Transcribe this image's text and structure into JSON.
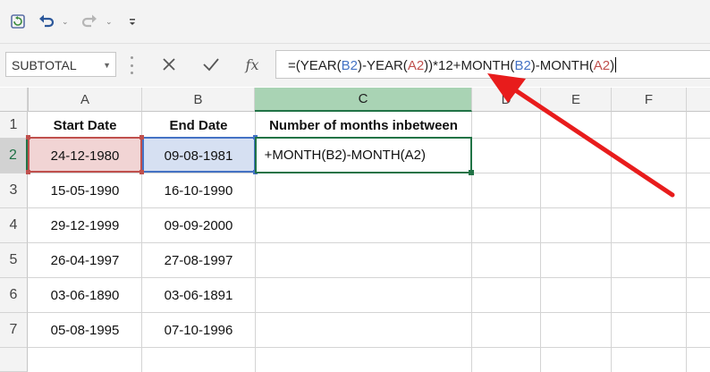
{
  "quick_access": {
    "icons": [
      "save-icon",
      "undo-icon",
      "redo-icon",
      "customize-icon"
    ]
  },
  "formula_bar": {
    "name_box": "SUBTOTAL",
    "fx_label": "fx",
    "formula_parts": [
      {
        "t": "=(YEAR(",
        "c": "n"
      },
      {
        "t": "B2",
        "c": "b"
      },
      {
        "t": ")-YEAR(",
        "c": "n"
      },
      {
        "t": "A2",
        "c": "a"
      },
      {
        "t": "))*12+MONTH(",
        "c": "n"
      },
      {
        "t": "B2",
        "c": "b"
      },
      {
        "t": ")-MONTH(",
        "c": "n"
      },
      {
        "t": "A2",
        "c": "a"
      },
      {
        "t": ")",
        "c": "n"
      }
    ]
  },
  "columns": [
    "A",
    "B",
    "C",
    "D",
    "E",
    "F"
  ],
  "rows": [
    "1",
    "2",
    "3",
    "4",
    "5",
    "6",
    "7"
  ],
  "headers": {
    "start_date": "Start Date",
    "end_date": "End Date",
    "months": "Number of months inbetween"
  },
  "data": [
    {
      "start": "24-12-1980",
      "end": "09-08-1981"
    },
    {
      "start": "15-05-1990",
      "end": "16-10-1990"
    },
    {
      "start": "29-12-1999",
      "end": "09-09-2000"
    },
    {
      "start": "26-04-1997",
      "end": "27-08-1997"
    },
    {
      "start": "03-06-1890",
      "end": "03-06-1891"
    },
    {
      "start": "05-08-1995",
      "end": "07-10-1996"
    }
  ],
  "editing_cell_text": "+MONTH(B2)-MONTH(A2)",
  "colors": {
    "selection": "#217346",
    "ref_a": "#c0504d",
    "ref_b": "#4472c4",
    "arrow": "#e81c1c"
  }
}
